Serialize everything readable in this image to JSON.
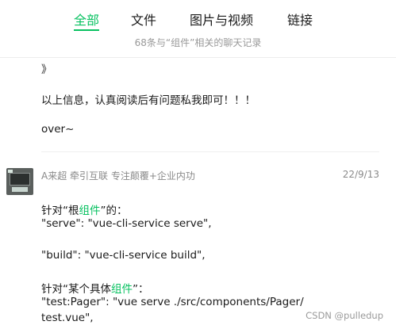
{
  "tabs": {
    "all": "全部",
    "files": "文件",
    "media": "图片与视频",
    "links": "链接"
  },
  "subtitle": "68条与“组件”相关的聊天记录",
  "prev_message": {
    "line1": "》",
    "line2": "以上信息，认真阅读后有问题私我即可！！！",
    "line3": " over~"
  },
  "message": {
    "sender": "A来超 牵引互联 专注颠覆+企业内功",
    "date": "22/9/13",
    "l1_pre": "针对“根",
    "l1_hl": "组件",
    "l1_post": "”的：",
    "l2": "\"serve\": \"vue-cli-service serve\",",
    "l3": "\"build\": \"vue-cli-service build\",",
    "l4_pre": "针对“某个具体",
    "l4_hl": "组件",
    "l4_post": "”：",
    "l5": "\"test:Pager\": \"vue serve ./src/components/Pager/",
    "l6": "test.vue\","
  },
  "watermark": "CSDN @pulledup"
}
